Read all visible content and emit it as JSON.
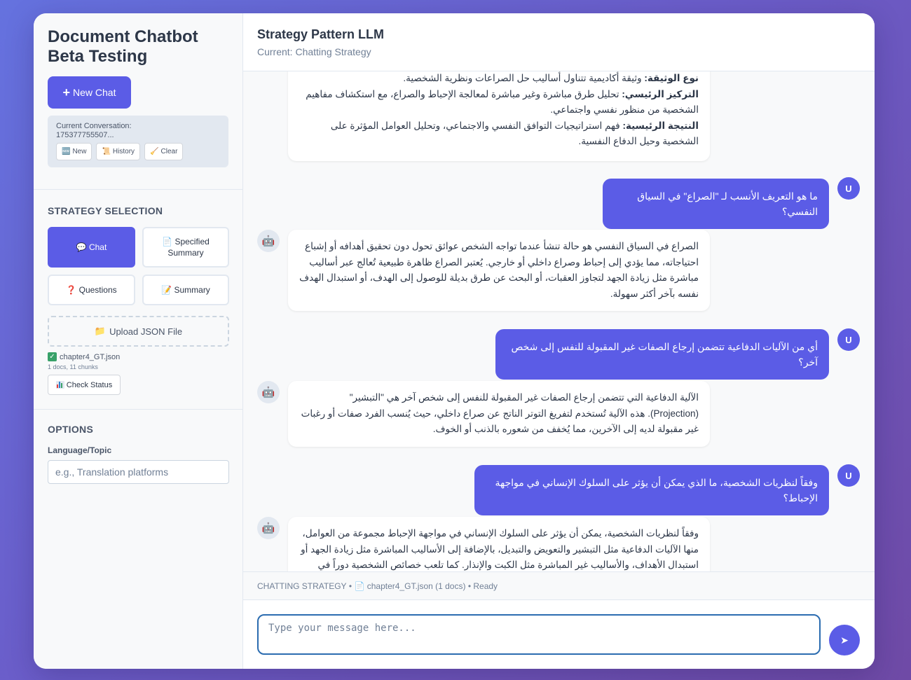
{
  "sidebar": {
    "title": "Document Chatbot Beta Testing",
    "new_chat_label": "New Chat",
    "conversation_label": "Current Conversation:",
    "conversation_id": "175377755507...",
    "mini_buttons": [
      {
        "icon": "🆕",
        "label": "New"
      },
      {
        "icon": "📜",
        "label": "History"
      },
      {
        "icon": "🧹",
        "label": "Clear"
      }
    ],
    "strategy_title": "STRATEGY SELECTION",
    "strategies": [
      {
        "icon": "💬",
        "label": "Chat",
        "active": true
      },
      {
        "icon": "📄",
        "label": "Specified Summary",
        "active": false
      },
      {
        "icon": "❓",
        "label": "Questions",
        "active": false
      },
      {
        "icon": "📝",
        "label": "Summary",
        "active": false
      }
    ],
    "upload_icon": "📁",
    "upload_label": "Upload JSON File",
    "file_name": "chapter4_GT.json",
    "file_meta": "1 docs, 11 chunks",
    "check_status_label": "Check Status",
    "options_title": "OPTIONS",
    "topic_label": "Language/Topic",
    "topic_placeholder": "e.g., Translation platforms"
  },
  "header": {
    "title": "Strategy Pattern LLM",
    "subtitle": "Current: Chatting Strategy"
  },
  "messages": [
    {
      "role": "bot",
      "lines": [
        {
          "bold": "نوع الوثيقة:",
          "text": " وثيقة أكاديمية تتناول أساليب حل الصراعات ونظرية الشخصية."
        },
        {
          "bold": "التركيز الرئيسي:",
          "text": " تحليل طرق مباشرة وغير مباشرة لمعالجة الإحباط والصراع، مع استكشاف مفاهيم الشخصية من منظور نفسي واجتماعي."
        },
        {
          "bold": "النتيجة الرئيسية:",
          "text": " فهم استراتيجيات التوافق النفسي والاجتماعي، وتحليل العوامل المؤثرة على الشخصية وحيل الدفاع النفسية."
        }
      ]
    },
    {
      "role": "user",
      "avatar": "U",
      "text": "ما هو التعريف الأنسب لـ \"الصراع\" في السياق النفسي؟"
    },
    {
      "role": "bot",
      "text": "الصراع في السياق النفسي هو حالة تنشأ عندما تواجه الشخص عوائق تحول دون تحقيق أهدافه أو إشباع احتياجاته، مما يؤدي إلى إحباط وصراع داخلي أو خارجي. يُعتبر الصراع ظاهرة طبيعية تُعالج عبر أساليب مباشرة مثل زيادة الجهد لتجاوز العقبات، أو البحث عن طرق بديلة للوصول إلى الهدف، أو استبدال الهدف نفسه بآخر أكثر سهولة."
    },
    {
      "role": "user",
      "avatar": "U",
      "text": "أي من الآليات الدفاعية تتضمن إرجاع الصفات غير المقبولة للنفس إلى شخص آخر؟"
    },
    {
      "role": "bot",
      "text": "الآلية الدفاعية التي تتضمن إرجاع الصفات غير المقبولة للنفس إلى شخص آخر هي \"التبشير\" (Projection). هذه الآلية تُستخدم لتفريغ التوتر الناتج عن صراع داخلي، حيث يُنسب الفرد صفات أو رغبات غير مقبولة لديه إلى الآخرين، مما يُخفف من شعوره بالذنب أو الخوف."
    },
    {
      "role": "user",
      "avatar": "U",
      "text": "وفقاً لنظريات الشخصية، ما الذي يمكن أن يؤثر على السلوك الإنساني في مواجهة الإحباط؟"
    },
    {
      "role": "bot",
      "text": "وفقاً لنظريات الشخصية، يمكن أن يؤثر على السلوك الإنساني في مواجهة الإحباط مجموعة من العوامل، منها الآليات الدفاعية مثل التبشير والتعويض والتبديل، بالإضافة إلى الأساليب المباشرة مثل زيادة الجهد أو استبدال الأهداف، والأساليب غير المباشرة مثل الكبت والإنذار. كما تلعب خصائص الشخصية دوراً في اختيار"
    }
  ],
  "status_bar": {
    "strategy": "CHATTING STRATEGY",
    "file": "chapter4_GT.json (1 docs)",
    "state": "Ready"
  },
  "composer": {
    "placeholder": "Type your message here...",
    "send_icon": "➤"
  },
  "colors": {
    "accent": "#5b5ce6",
    "background_gradient_start": "#6572df",
    "background_gradient_end": "#6f4aa6"
  }
}
